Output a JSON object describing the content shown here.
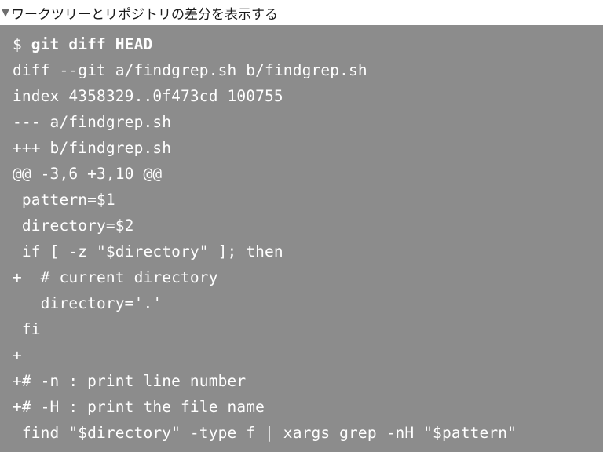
{
  "caption": {
    "marker": "▼",
    "text": "ワークツリーとリポジトリの差分を表示する"
  },
  "code": {
    "prompt": "$ ",
    "command": "git diff HEAD",
    "lines": [
      "diff --git a/findgrep.sh b/findgrep.sh",
      "index 4358329..0f473cd 100755",
      "--- a/findgrep.sh",
      "+++ b/findgrep.sh",
      "@@ -3,6 +3,10 @@",
      " pattern=$1",
      " directory=$2",
      " if [ -z \"$directory\" ]; then",
      "+  # current directory",
      "   directory='.'",
      " fi",
      "+",
      "+# -n : print line number",
      "+# -H : print the file name",
      " find \"$directory\" -type f | xargs grep -nH \"$pattern\""
    ]
  },
  "colors": {
    "code_background": "#8c8c8c",
    "code_text": "#ffffff",
    "caption_text": "#1a1a1a"
  }
}
